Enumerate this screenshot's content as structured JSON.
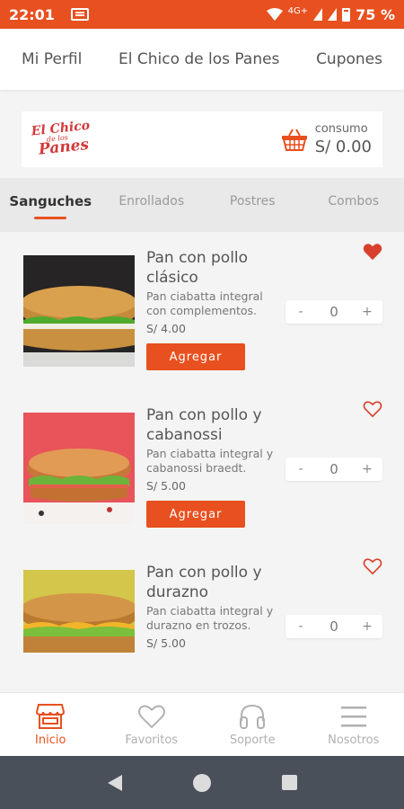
{
  "status_bar": {
    "time": "22:01",
    "network": "4G+",
    "battery": "75 %"
  },
  "top_nav": {
    "items": [
      "Mi Perfil",
      "El Chico de los Panes",
      "Cupones"
    ]
  },
  "brand": {
    "logo_line1": "El Chico",
    "logo_line2": "de los",
    "logo_line3": "Panes",
    "cart_label": "consumo",
    "cart_total": "S/ 0.00"
  },
  "tabs": {
    "items": [
      "Sanguches",
      "Enrollados",
      "Postres",
      "Combos"
    ],
    "active": "Sanguches"
  },
  "products": [
    {
      "name": "Pan con pollo clásico",
      "description": "Pan ciabatta integral con complementos.",
      "price": "S/ 4.00",
      "quantity": "0",
      "favorite": true,
      "button": "Agregar",
      "image_bg": "#2b2a2a"
    },
    {
      "name": "Pan con pollo y cabanossi",
      "description": "Pan ciabatta integral y cabanossi braedt.",
      "price": "S/ 5.00",
      "quantity": "0",
      "favorite": false,
      "button": "Agregar",
      "image_bg": "#e8545a"
    },
    {
      "name": "Pan con pollo y durazno",
      "description": "Pan ciabatta integral y durazno en trozos.",
      "price": "S/ 5.00",
      "quantity": "0",
      "favorite": false,
      "image_bg": "#d3c64a"
    }
  ],
  "stepper": {
    "minus": "-",
    "plus": "+"
  },
  "bottom_nav": {
    "items": [
      {
        "label": "Inicio",
        "icon": "store-icon",
        "active": true
      },
      {
        "label": "Favoritos",
        "icon": "heart-icon",
        "active": false
      },
      {
        "label": "Soporte",
        "icon": "headset-icon",
        "active": false
      },
      {
        "label": "Nosotros",
        "icon": "menu-icon",
        "active": false
      }
    ]
  },
  "colors": {
    "accent": "#e8501f",
    "heart": "#d8402d"
  }
}
